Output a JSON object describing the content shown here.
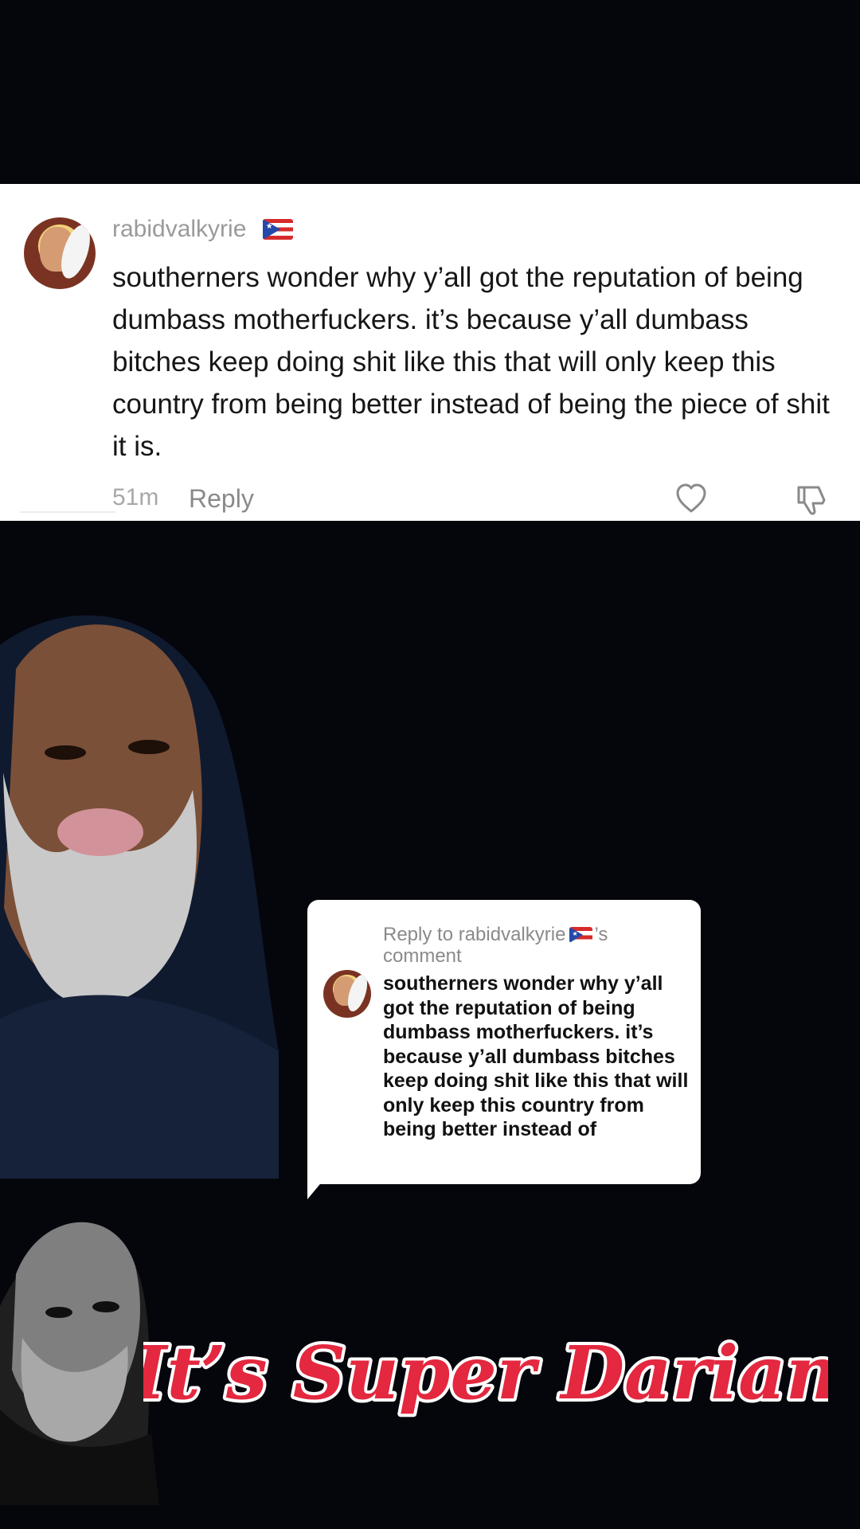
{
  "comment": {
    "username": "rabidvalkyrie",
    "text": "southerners wonder why y’all got the reputation of being dumbass motherfuckers. it’s because y’all dumbass bitches keep doing shit like this that will only keep this country from being better instead of being the piece of shit it is.",
    "time": "51m",
    "reply_label": "Reply",
    "icons": [
      "avatar",
      "puerto-rico-flag-icon",
      "heart-icon",
      "dislike-icon"
    ]
  },
  "reply_bubble": {
    "reply_prefix": "Reply to rabidvalkyrie",
    "reply_suffix": "’s comment",
    "text": "southerners wonder why y’all got the reputation of being dumbass motherfuckers. it’s because y’all dumbass bitches keep doing shit like this that will only keep this country from being better instead of"
  },
  "branding": {
    "title": "It’s Super Darian",
    "colors": {
      "fill": "#e3283f",
      "outline": "#ffffff"
    }
  },
  "colors": {
    "background": "#05060c",
    "card_background": "#ffffff",
    "username": "#9a9a9a",
    "comment_text": "#161616",
    "muted": "#a8a8a8"
  }
}
